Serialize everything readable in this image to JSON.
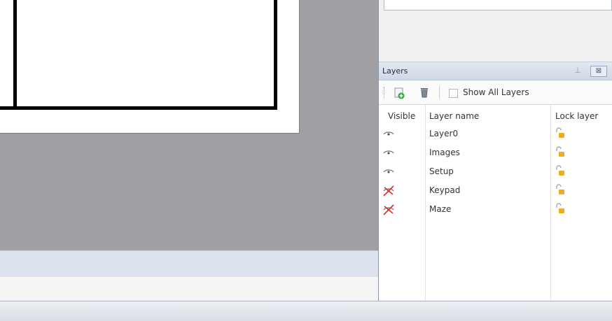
{
  "layers_panel": {
    "title": "Layers",
    "pin_glyph": "⊥",
    "close_glyph": "⊠",
    "toolbar": {
      "add_layer_icon": "add-layer-icon",
      "delete_layer_icon": "delete-layer-icon",
      "show_all_label": "Show All Layers",
      "show_all_checked": false
    },
    "columns": {
      "visible": "Visible",
      "name": "Layer name",
      "lock": "Lock layer"
    },
    "rows": [
      {
        "name": "Layer0",
        "visible": true,
        "locked": false
      },
      {
        "name": "Images",
        "visible": true,
        "locked": false
      },
      {
        "name": "Setup",
        "visible": true,
        "locked": false
      },
      {
        "name": "Keypad",
        "visible": false,
        "locked": false
      },
      {
        "name": "Maze",
        "visible": false,
        "locked": false
      }
    ]
  },
  "colors": {
    "canvas_bg": "#a0a0a4",
    "panel_title_bg": "#dbe3ef",
    "hidden_mark": "#d0342c",
    "lock_accent": "#e8b020"
  }
}
